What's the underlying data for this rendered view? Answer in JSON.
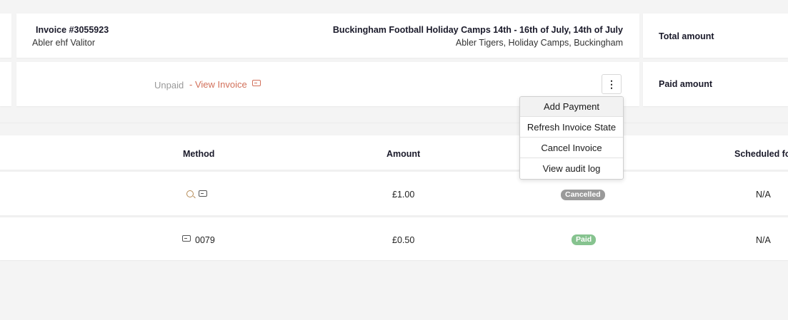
{
  "invoice": {
    "number": "Invoice #3055923",
    "provider": "Abler ehf Valitor",
    "title": "Buckingham Football Holiday Camps 14th - 16th of July, 14th of July",
    "subtitle": "Abler Tigers, Holiday Camps, Buckingham",
    "status": "Unpaid",
    "view_link": "- View Invoice"
  },
  "summary": {
    "total_label": "Total amount",
    "paid_label": "Paid amount"
  },
  "menu": {
    "button_glyph": "⋮",
    "items": [
      "Add Payment",
      "Refresh Invoice State",
      "Cancel Invoice",
      "View audit log"
    ]
  },
  "table": {
    "headers": {
      "method": "Method",
      "amount": "Amount",
      "scheduled": "Scheduled fo"
    },
    "rows": [
      {
        "method_icons": [
          "search-icon",
          "card-icon"
        ],
        "method_text": "",
        "amount": "£1.00",
        "status": "Cancelled",
        "scheduled": "N/A"
      },
      {
        "method_icons": [
          "card-icon"
        ],
        "method_text": "0079",
        "amount": "£0.50",
        "status": "Paid",
        "scheduled": "N/A"
      }
    ]
  },
  "colors": {
    "link": "#d2705a",
    "cancelled_badge": "#9a9a9a",
    "paid_badge": "#86c38f",
    "muted": "#999999",
    "method_icon": "#b58a55"
  }
}
